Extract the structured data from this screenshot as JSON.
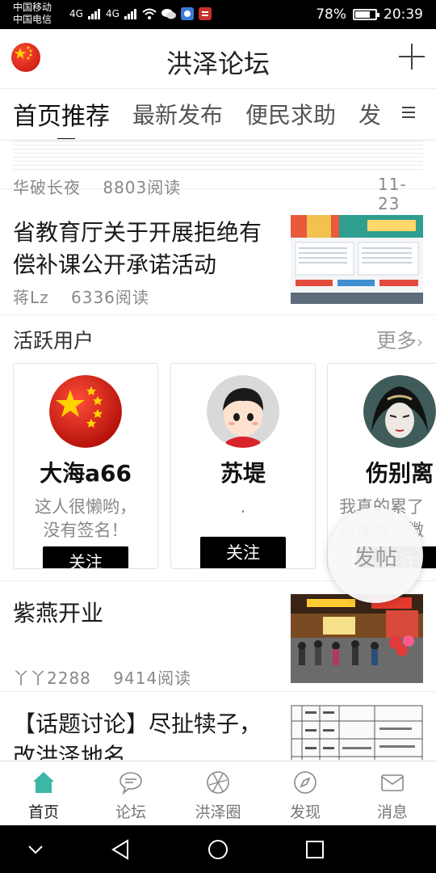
{
  "status_bar": {
    "carrier1": "中国移动",
    "carrier2": "中国电信",
    "signal1": "4G",
    "signal2": "4G",
    "battery_pct": "78%",
    "battery_level": 0.78,
    "time": "20:39"
  },
  "header": {
    "title": "洪泽论坛"
  },
  "tabs": [
    {
      "label": "首页推荐",
      "active": true
    },
    {
      "label": "最新发布",
      "active": false
    },
    {
      "label": "便民求助",
      "active": false
    },
    {
      "label": "发",
      "active": false
    }
  ],
  "feed": {
    "partial_post": {
      "author": "华破长夜",
      "views": "8803阅读",
      "date": "11-23"
    },
    "post1": {
      "title": "省教育厅关于开展拒绝有偿补课公开承诺活动",
      "author": "蒋Lz",
      "views": "6336阅读"
    },
    "post2": {
      "title": "紫燕开业",
      "author": "丫丫2288",
      "views": "9414阅读"
    },
    "post3": {
      "title": "【话题讨论】尽扯犊子，改洪泽地名"
    }
  },
  "active_users": {
    "title": "活跃用户",
    "more": "更多",
    "users": [
      {
        "name": "大海a66",
        "signature": "这人很懒哟，\n没有签名！",
        "follow": "关注"
      },
      {
        "name": "苏堤",
        "signature": ".",
        "follow": "关注"
      },
      {
        "name": "伤别离",
        "signature": "我真的累了\n能懂我，微",
        "follow": "关注"
      }
    ]
  },
  "fab": {
    "label": "发帖"
  },
  "bottom_tabs": [
    {
      "label": "首页",
      "icon": "home-icon",
      "active": true
    },
    {
      "label": "论坛",
      "icon": "chat-bubble-icon",
      "active": false
    },
    {
      "label": "洪泽圈",
      "icon": "aperture-icon",
      "active": false
    },
    {
      "label": "发现",
      "icon": "compass-icon",
      "active": false
    },
    {
      "label": "消息",
      "icon": "envelope-icon",
      "active": false
    }
  ],
  "colors": {
    "accent": "#3cb7a6",
    "text": "#1a1a1a",
    "muted": "#888888",
    "flag_red": "#d4140c"
  }
}
